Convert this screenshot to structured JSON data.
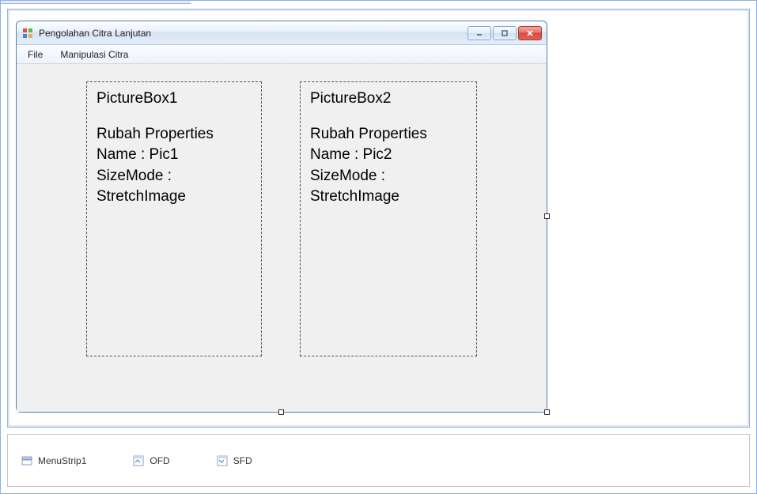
{
  "window": {
    "title": "Pengolahan Citra Lanjutan"
  },
  "menu": {
    "file": "File",
    "manipulasi": "Manipulasi Citra"
  },
  "picturebox1": {
    "title": "PictureBox1",
    "line1": "Rubah Properties",
    "line2": "Name : Pic1",
    "line3": "SizeMode :",
    "line4": "StretchImage"
  },
  "picturebox2": {
    "title": "PictureBox2",
    "line1": "Rubah Properties",
    "line2": "Name : Pic2",
    "line3": "SizeMode :",
    "line4": "StretchImage"
  },
  "tray": {
    "menustrip": "MenuStrip1",
    "ofd": "OFD",
    "sfd": "SFD"
  }
}
